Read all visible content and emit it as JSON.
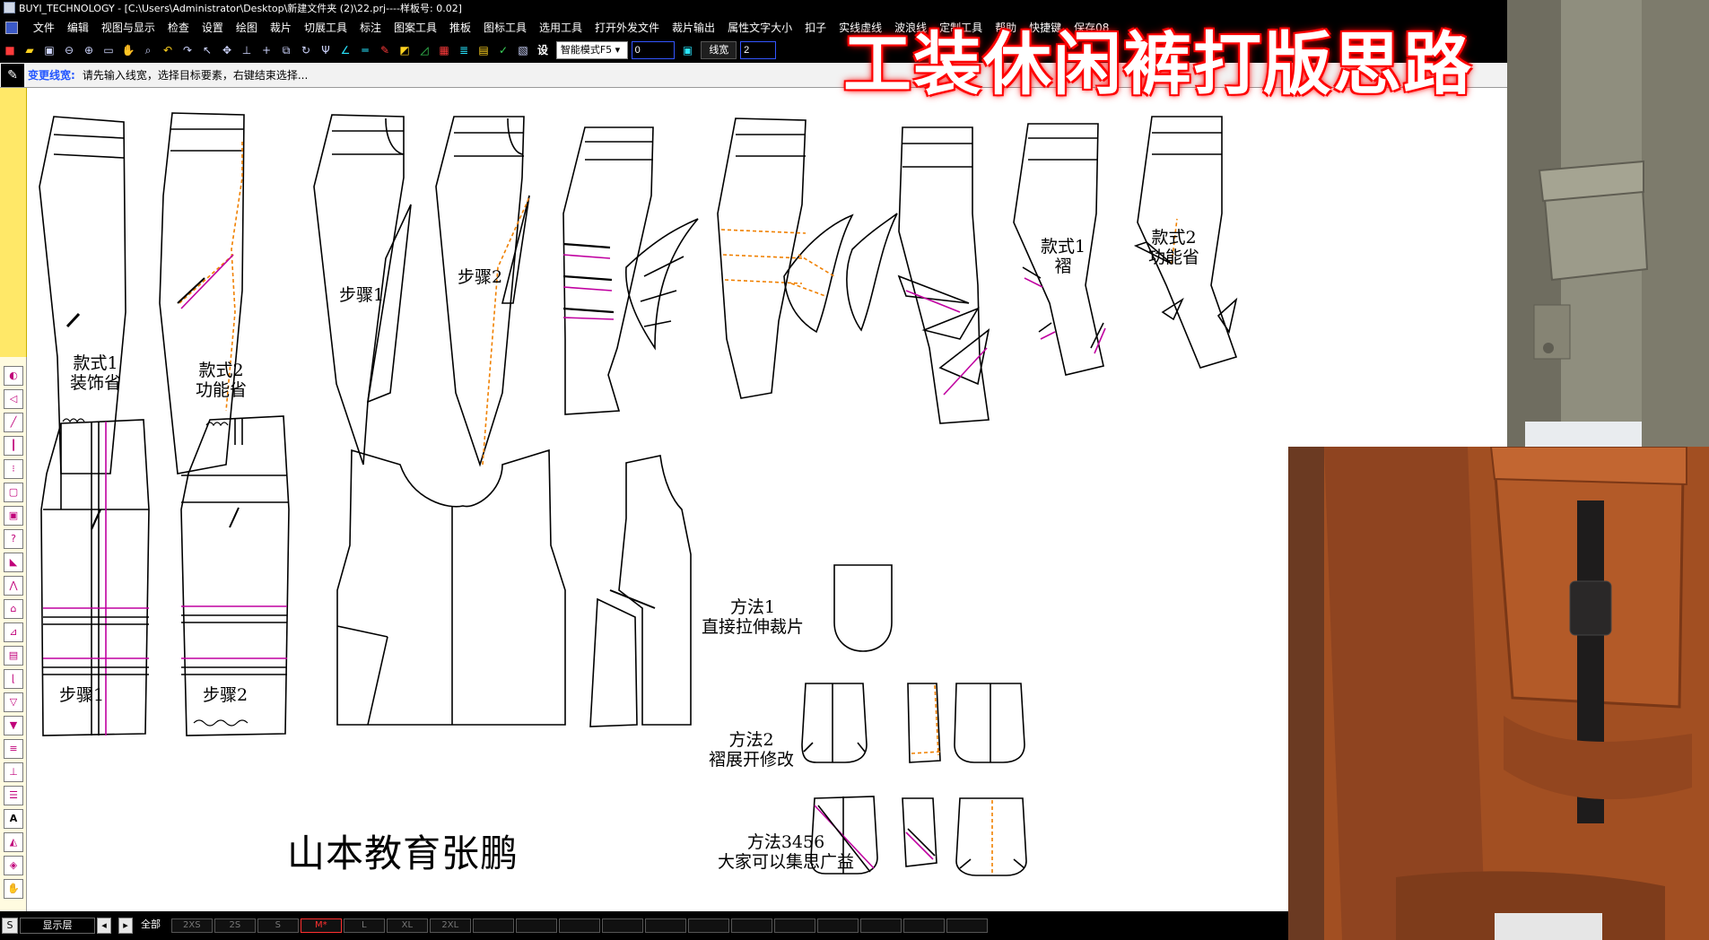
{
  "window": {
    "title": "BUYI_TECHNOLOGY - [C:\\Users\\Administrator\\Desktop\\新建文件夹 (2)\\22.prj----样板号: 0.02]"
  },
  "menu": [
    "文件",
    "编辑",
    "视图与显示",
    "检查",
    "设置",
    "绘图",
    "裁片",
    "切展工具",
    "标注",
    "图案工具",
    "推板",
    "图标工具",
    "选用工具",
    "打开外发文件",
    "裁片输出",
    "属性文字大小",
    "扣子",
    "实线虚线",
    "波浪线",
    "定制工具",
    "帮助",
    "快捷键",
    "保存08"
  ],
  "toolbar": {
    "mode_select": "智能模式F5",
    "value_input": "0",
    "line_width_label": "线宽",
    "line_width_value": "2",
    "icons": [
      "new-icon",
      "open-icon",
      "save-icon",
      "zoom-out-icon",
      "zoom-in-icon",
      "zoom-window-icon",
      "pan-icon",
      "zoom-fit-icon",
      "undo-icon",
      "redo-icon",
      "select-icon",
      "move-icon",
      "point-icon",
      "plus-icon",
      "copy-icon",
      "rotate-icon",
      "fork-icon",
      "angle-icon",
      "parallel-icon",
      "pencil-icon",
      "fill-icon",
      "measure-icon",
      "color-icon",
      "layer-icon",
      "grid-icon",
      "check-icon",
      "image-icon"
    ],
    "settings_label": "设"
  },
  "status": {
    "mode": "变更线宽:",
    "prompt": "请先输入线宽，选择目标要素，右键结束选择..."
  },
  "banner": "工装休闲裤打版思路",
  "notes": {
    "style1": [
      "款式1",
      "装饰省"
    ],
    "style2": [
      "款式2",
      "功能省"
    ],
    "step1a": "步骤1",
    "step2a": "步骤2",
    "style1b": [
      "款式1",
      "褶"
    ],
    "style2b": [
      "款式2",
      "功能省"
    ],
    "step1b": "步骤1",
    "step2b": "步骤2",
    "method1": [
      "方法1",
      "直接拉伸裁片"
    ],
    "method2": [
      "方法2",
      "褶展开修改"
    ],
    "method3": [
      "方法3456",
      "大家可以集思广益"
    ]
  },
  "watermark": "山本教育张鹏",
  "bottom": {
    "layer_label": "显示层",
    "all_label": "全部",
    "s_label": "S",
    "sizes": [
      "2XS",
      "2S",
      "S",
      "M*",
      "L",
      "XL",
      "2XL",
      "",
      "",
      "",
      "",
      "",
      "",
      "",
      "",
      "",
      "",
      "",
      "",
      "",
      "",
      "",
      ""
    ],
    "active_size": "M*"
  },
  "colors": {
    "dashed_guide": "#f08000",
    "magenta_line": "#c000a0",
    "banner_glow": "#ff0000",
    "photo_top": "#8f8e7e",
    "photo_bottom": "#a24f22"
  }
}
